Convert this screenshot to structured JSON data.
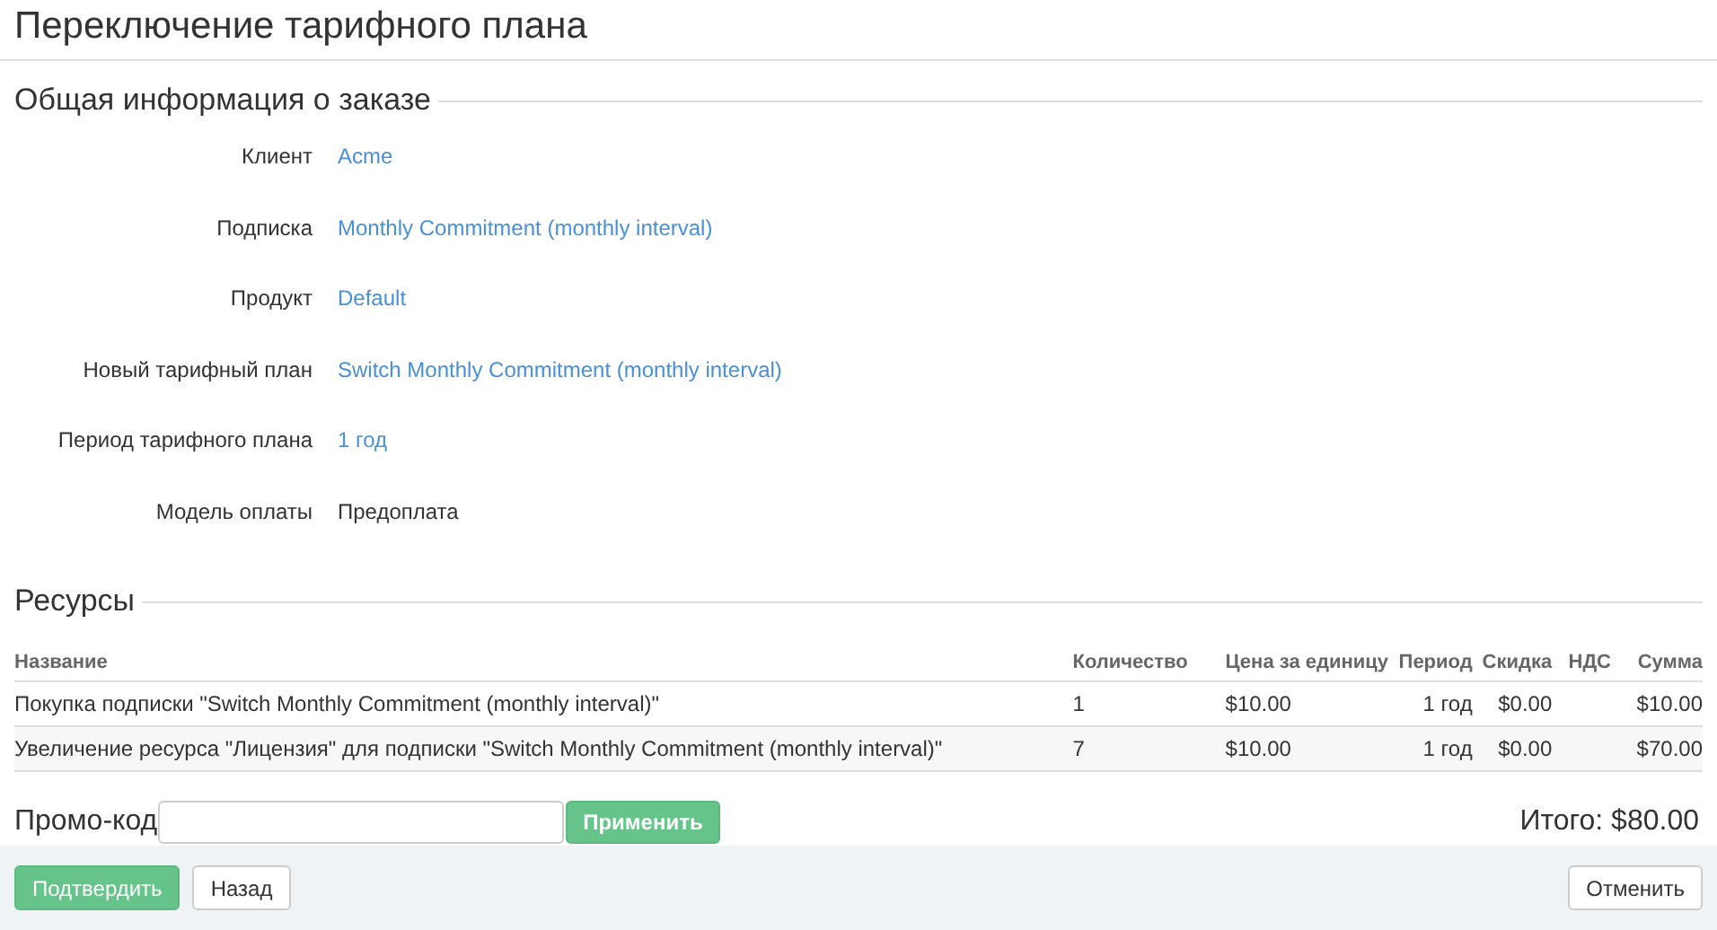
{
  "page_title": "Переключение тарифного плана",
  "order_info": {
    "heading": "Общая информация о заказе",
    "fields": [
      {
        "label": "Клиент",
        "value": "Acme",
        "kind": "link"
      },
      {
        "label": "Подписка",
        "value": "Monthly Commitment (monthly interval)",
        "kind": "link"
      },
      {
        "label": "Продукт",
        "value": "Default",
        "kind": "link"
      },
      {
        "label": "Новый тарифный план",
        "value": "Switch Monthly Commitment (monthly interval)",
        "kind": "link"
      },
      {
        "label": "Период тарифного плана",
        "value": "1 год",
        "kind": "link"
      },
      {
        "label": "Модель оплаты",
        "value": "Предоплата",
        "kind": "text"
      }
    ]
  },
  "resources": {
    "heading": "Ресурсы",
    "table": {
      "columns": [
        "Название",
        "Количество",
        "Цена за единицу",
        "Период",
        "Скидка",
        "НДС",
        "Сумма"
      ],
      "rows": [
        [
          "Покупка подписки \"Switch Monthly Commitment (monthly interval)\"",
          "1",
          "$10.00",
          "1 год",
          "$0.00",
          "",
          "$10.00"
        ],
        [
          "Увеличение ресурса \"Лицензия\" для подписки \"Switch Monthly Commitment (monthly interval)\"",
          "7",
          "$10.00",
          "1 год",
          "$0.00",
          "",
          "$70.00"
        ]
      ]
    }
  },
  "promo": {
    "label": "Промо-код",
    "apply_button": "Применить"
  },
  "total": "Итого: $80.00",
  "footer": {
    "confirm_button": "Подтвердить",
    "back_button": "Назад",
    "cancel_button": "Отменить"
  }
}
